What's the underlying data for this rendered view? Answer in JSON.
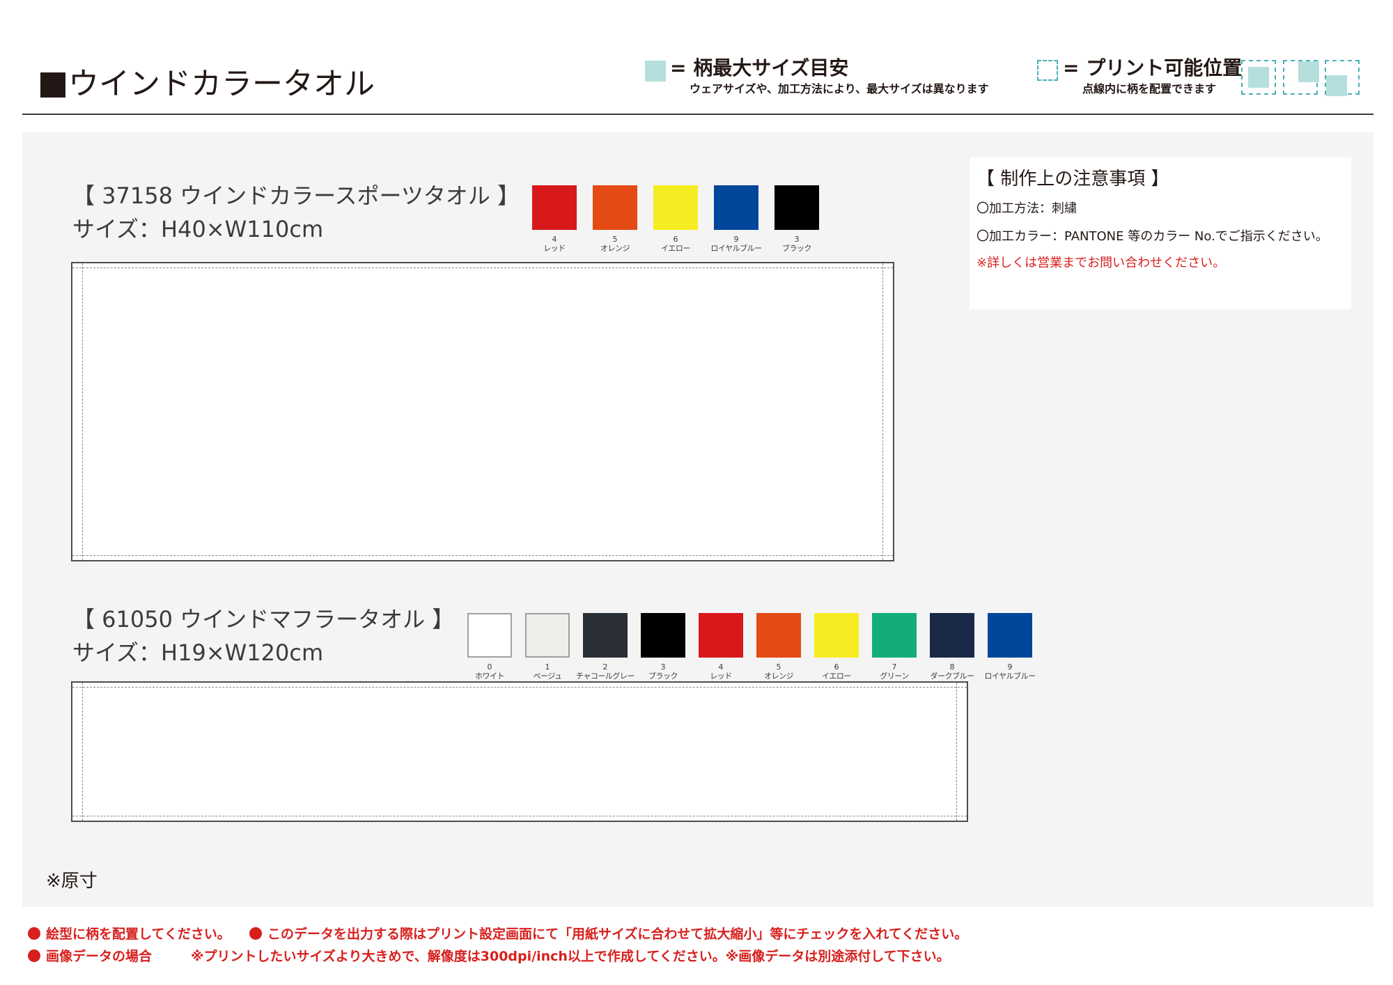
{
  "header": {
    "title": "ウインドカラータオル",
    "legend_max_size": {
      "label": "= 柄最大サイズ目安",
      "note": "ウェアサイズや、加工方法により、最大サイズは異なります"
    },
    "legend_print_area": {
      "label": "= プリント可能位置",
      "note": "点線内に柄を配置できます"
    }
  },
  "products": [
    {
      "name": "【 37158 ウインドカラースポーツタオル 】",
      "size": "サイズ：H40×W110cm",
      "colors": [
        {
          "num": "4",
          "name": "レッド",
          "hex": "#d7191c"
        },
        {
          "num": "5",
          "name": "オレンジ",
          "hex": "#e44a13"
        },
        {
          "num": "6",
          "name": "イエロー",
          "hex": "#f6ec22"
        },
        {
          "num": "9",
          "name": "ロイヤルブルー",
          "hex": "#00469b"
        },
        {
          "num": "3",
          "name": "ブラック",
          "hex": "#000000"
        }
      ]
    },
    {
      "name": "【 61050 ウインドマフラータオル 】",
      "size": "サイズ：H19×W120cm",
      "colors": [
        {
          "num": "0",
          "name": "ホワイト",
          "hex": "#ffffff"
        },
        {
          "num": "1",
          "name": "ベージュ",
          "hex": "#efedea"
        },
        {
          "num": "2",
          "name": "チャコールグレー",
          "hex": "#2a2f35"
        },
        {
          "num": "3",
          "name": "ブラック",
          "hex": "#000000"
        },
        {
          "num": "4",
          "name": "レッド",
          "hex": "#d7191c"
        },
        {
          "num": "5",
          "name": "オレンジ",
          "hex": "#e44a13"
        },
        {
          "num": "6",
          "name": "イエロー",
          "hex": "#f6ec22"
        },
        {
          "num": "7",
          "name": "グリーン",
          "hex": "#13ad7b"
        },
        {
          "num": "8",
          "name": "ダークブルー",
          "hex": "#1b2948"
        },
        {
          "num": "9",
          "name": "ロイヤルブルー",
          "hex": "#00469b"
        }
      ]
    }
  ],
  "notes": {
    "heading": "【 制作上の注意事項 】",
    "line1": "〇加工方法：刺繍",
    "line2": "〇加工カラー：PANTONE 等のカラー No.でご指示ください。",
    "warning": "※詳しくは営業までお問い合わせください。"
  },
  "actual_size": "※原寸",
  "footer": {
    "line1a": "絵型に柄を配置してください。",
    "line1b": "このデータを出力する際はプリント設定画面にて「用紙サイズに合わせて拡大縮小」等にチェックを入れてください。",
    "line2a": "画像データの場合",
    "line2b": "※プリントしたいサイズより大きめで、解像度は300dpi/inch以上で作成してください。※画像データは別途添付して下さい。"
  },
  "colors": {
    "accent_red": "#d7201d",
    "legend_fill": "#b5dfdc",
    "legend_border": "#48b0b8",
    "panel_bg": "#f4f4f4"
  }
}
